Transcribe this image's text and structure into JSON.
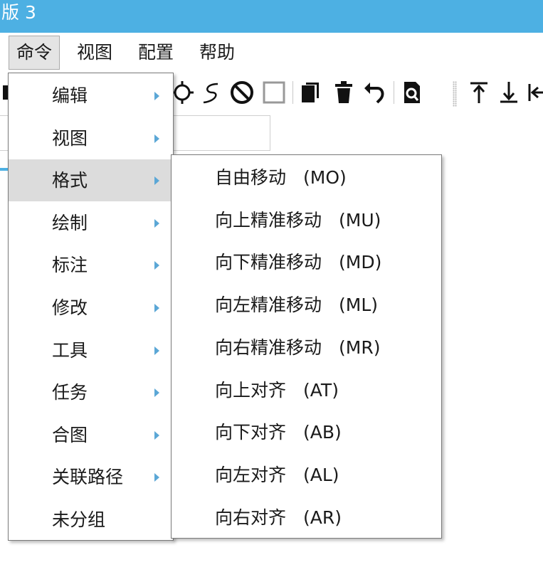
{
  "window": {
    "title": "版 3"
  },
  "menubar": {
    "items": [
      {
        "label": "命令"
      },
      {
        "label": "视图"
      },
      {
        "label": "配置"
      },
      {
        "label": "帮助"
      }
    ]
  },
  "toolbar": {
    "icons": [
      "crosshair-icon",
      "lasso-icon",
      "prohibit-icon",
      "square-icon",
      "copy-icon",
      "trash-icon",
      "undo-icon",
      "zoom-page-icon",
      "align-top-icon",
      "align-bottom-icon",
      "align-left-icon"
    ]
  },
  "dropdown": {
    "items": [
      {
        "label": "编辑",
        "has_submenu": true
      },
      {
        "label": "视图",
        "has_submenu": true
      },
      {
        "label": "格式",
        "has_submenu": true,
        "highlighted": true
      },
      {
        "label": "绘制",
        "has_submenu": true
      },
      {
        "label": "标注",
        "has_submenu": true
      },
      {
        "label": "修改",
        "has_submenu": true
      },
      {
        "label": "工具",
        "has_submenu": true
      },
      {
        "label": "任务",
        "has_submenu": true
      },
      {
        "label": "合图",
        "has_submenu": true
      },
      {
        "label": "关联路径",
        "has_submenu": true
      },
      {
        "label": "未分组",
        "has_submenu": false
      }
    ]
  },
  "submenu": {
    "items": [
      {
        "label": "自由移动",
        "code": "(MO)"
      },
      {
        "label": "向上精准移动",
        "code": "(MU)"
      },
      {
        "label": "向下精准移动",
        "code": "(MD)"
      },
      {
        "label": "向左精准移动",
        "code": "(ML)"
      },
      {
        "label": "向右精准移动",
        "code": "(MR)"
      },
      {
        "label": "向上对齐",
        "code": "(AT)"
      },
      {
        "label": "向下对齐",
        "code": "(AB)"
      },
      {
        "label": "向左对齐",
        "code": "(AL)"
      },
      {
        "label": "向右对齐",
        "code": "(AR)"
      }
    ]
  },
  "colors": {
    "titlebar": "#4db0e3",
    "highlight": "#dcdcdc",
    "arrow": "#5ba7d6"
  }
}
